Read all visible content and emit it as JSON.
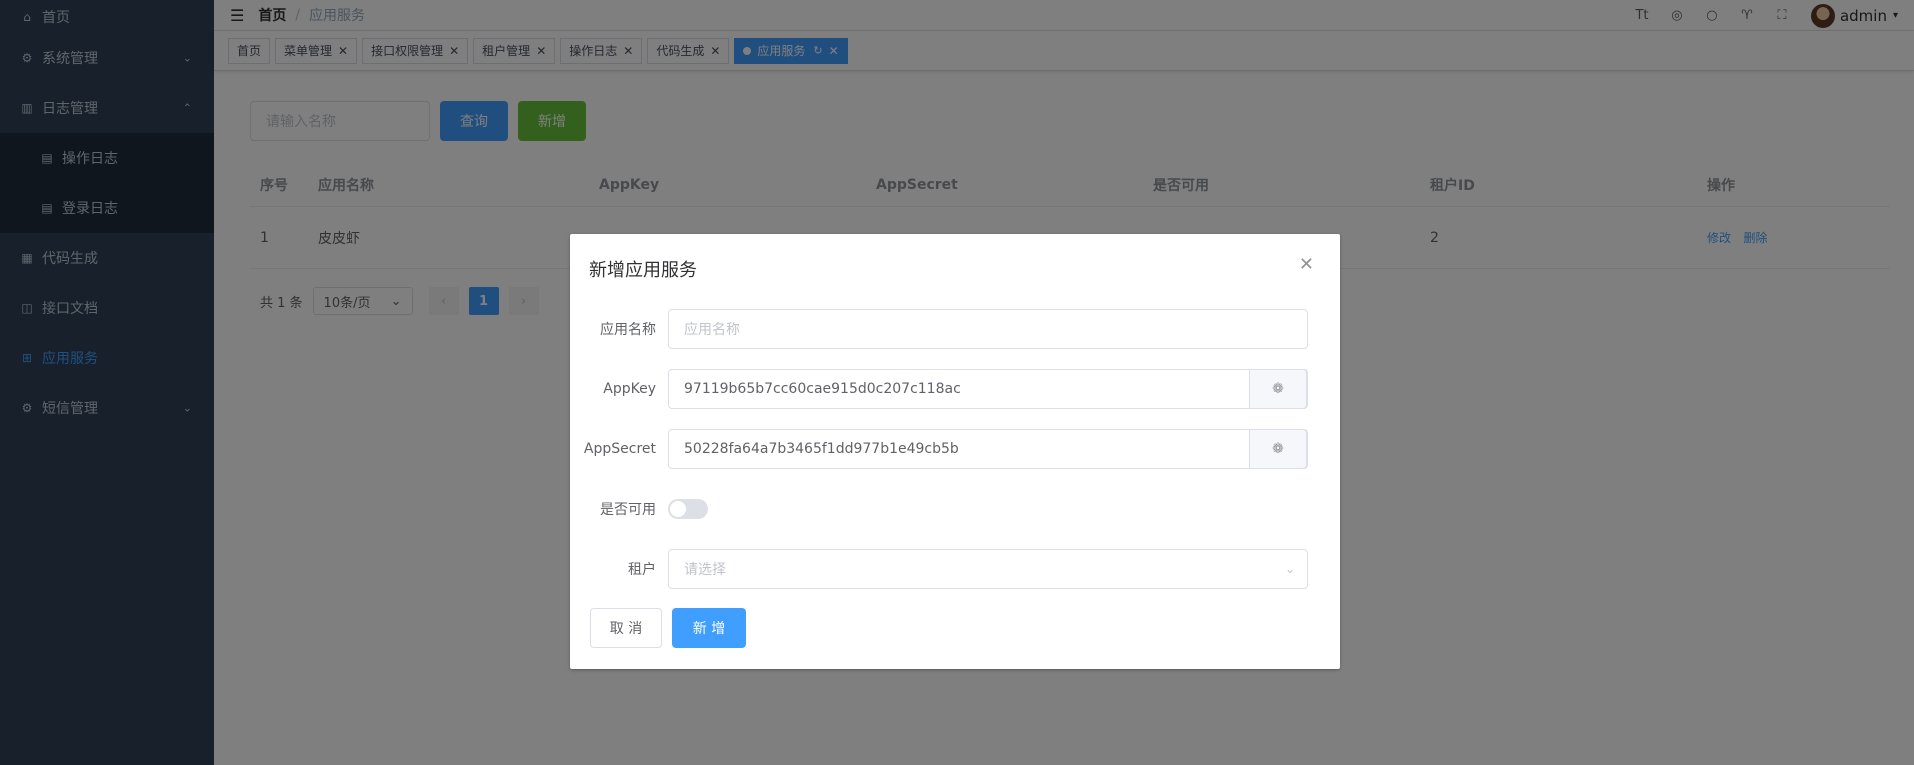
{
  "sidebar": {
    "items": [
      {
        "label": "首页",
        "icon": "home-icon"
      },
      {
        "label": "系统管理",
        "icon": "gear-icon",
        "arrow": "down"
      },
      {
        "label": "日志管理",
        "icon": "chart-icon",
        "arrow": "up"
      },
      {
        "label": "操作日志",
        "icon": "doc-icon"
      },
      {
        "label": "登录日志",
        "icon": "doc-icon"
      },
      {
        "label": "代码生成",
        "icon": "code-icon"
      },
      {
        "label": "接口文档",
        "icon": "book-icon"
      },
      {
        "label": "应用服务",
        "icon": "apps-icon"
      },
      {
        "label": "短信管理",
        "icon": "gear-icon",
        "arrow": "down"
      }
    ]
  },
  "breadcrumb": {
    "home": "首页",
    "current": "应用服务"
  },
  "header": {
    "user": "admin"
  },
  "tags": [
    {
      "label": "首页"
    },
    {
      "label": "菜单管理"
    },
    {
      "label": "接口权限管理"
    },
    {
      "label": "租户管理"
    },
    {
      "label": "操作日志"
    },
    {
      "label": "代码生成"
    },
    {
      "label": "应用服务"
    }
  ],
  "search": {
    "placeholder": "请输入名称",
    "query_label": "查询",
    "add_label": "新增"
  },
  "table": {
    "headers": [
      "序号",
      "应用名称",
      "AppKey",
      "AppSecret",
      "是否可用",
      "租户ID",
      "操作"
    ],
    "rows": [
      {
        "index": "1",
        "name": "皮皮虾",
        "appkey": "",
        "appsecret": "",
        "enabled": "",
        "tenant": "2",
        "edit": "修改",
        "delete": "删除"
      }
    ]
  },
  "pagination": {
    "total": "共 1 条",
    "page_size": "10条/页",
    "current": "1"
  },
  "dialog": {
    "title": "新增应用服务",
    "fields": {
      "name_label": "应用名称",
      "name_placeholder": "应用名称",
      "appkey_label": "AppKey",
      "appkey_value": "97119b65b7cc60cae915d0c207c118ac",
      "appsecret_label": "AppSecret",
      "appsecret_value": "50228fa64a7b3465f1dd977b1e49cb5b",
      "enabled_label": "是否可用",
      "tenant_label": "租户",
      "tenant_placeholder": "请选择"
    },
    "cancel_label": "取 消",
    "submit_label": "新 增"
  },
  "colors": {
    "sidebar_bg": "#304156",
    "primary": "#409eff",
    "success": "#67c23a"
  }
}
